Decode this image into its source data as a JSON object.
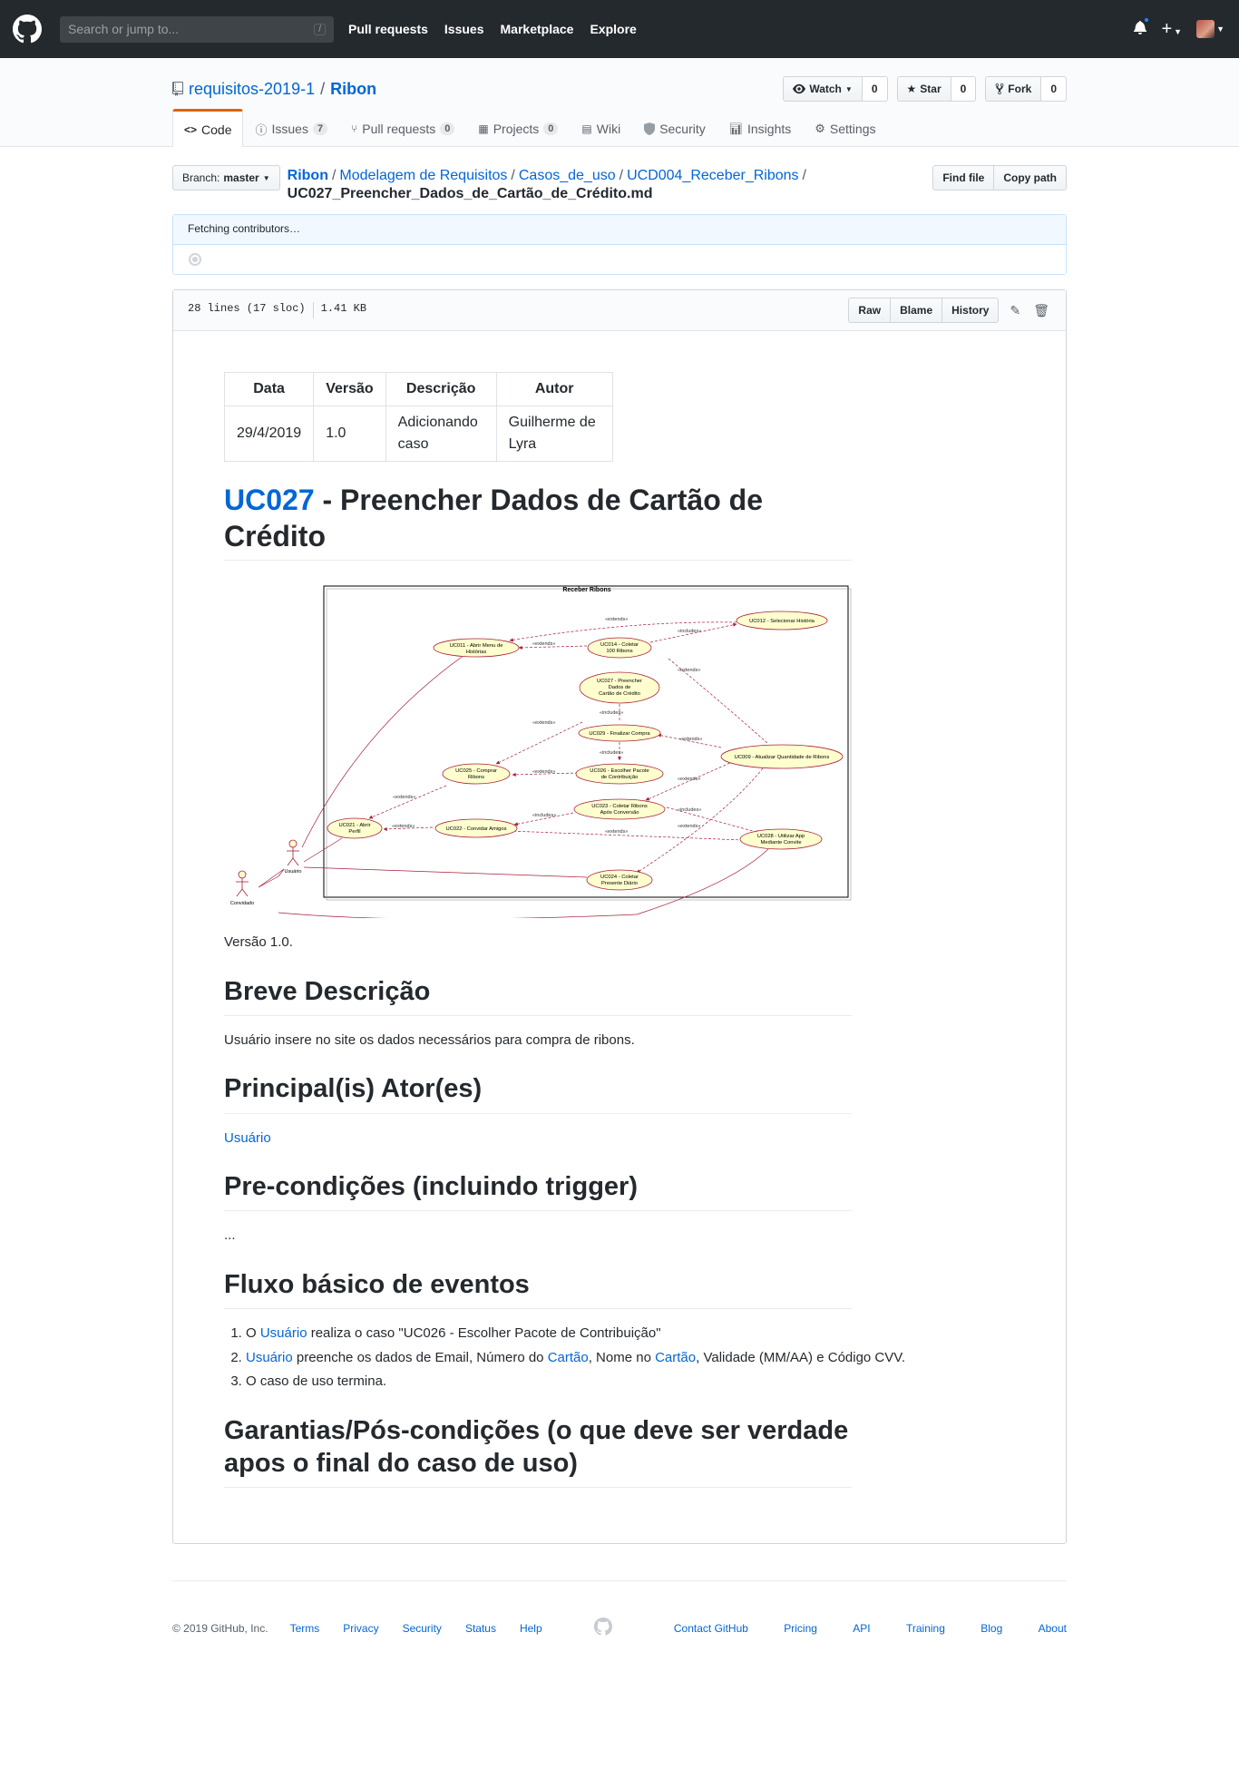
{
  "header": {
    "search_placeholder": "Search or jump to...",
    "search_key": "/",
    "nav": [
      "Pull requests",
      "Issues",
      "Marketplace",
      "Explore"
    ],
    "plus": "+"
  },
  "repo": {
    "owner": "requisitos-2019-1",
    "name": "Ribon",
    "watch_label": "Watch",
    "watch_count": "0",
    "star_label": "Star",
    "star_count": "0",
    "fork_label": "Fork",
    "fork_count": "0",
    "tabs": [
      {
        "label": "Code",
        "icon": "code-icon"
      },
      {
        "label": "Issues",
        "count": "7",
        "icon": "issue-icon"
      },
      {
        "label": "Pull requests",
        "count": "0",
        "icon": "pr-icon"
      },
      {
        "label": "Projects",
        "count": "0",
        "icon": "project-icon"
      },
      {
        "label": "Wiki",
        "icon": "book-icon"
      },
      {
        "label": "Security",
        "icon": "shield-icon"
      },
      {
        "label": "Insights",
        "icon": "graph-icon"
      },
      {
        "label": "Settings",
        "icon": "gear-icon"
      }
    ]
  },
  "breadcrumb": {
    "branch_prefix": "Branch:",
    "branch": "master",
    "root": "Ribon",
    "path": [
      "Modelagem de Requisitos",
      "Casos_de_uso",
      "UCD004_Receber_Ribons"
    ],
    "file": "UC027_Preencher_Dados_de_Cartão_de_Crédito.md",
    "find_file": "Find file",
    "copy_path": "Copy path"
  },
  "contributors": {
    "text": "Fetching contributors…"
  },
  "file": {
    "lines": "28 lines (17 sloc)",
    "size": "1.41 KB",
    "raw": "Raw",
    "blame": "Blame",
    "history": "History"
  },
  "doc": {
    "table_headers": [
      "Data",
      "Versão",
      "Descrição",
      "Autor"
    ],
    "table_row": [
      "29/4/2019",
      "1.0",
      "Adicionando caso",
      "Guilherme de Lyra"
    ],
    "title_link": "UC027",
    "title_rest": " - Preencher Dados de Cartão de Crédito",
    "diagram": {
      "title": "Receber Ribons",
      "usecases": {
        "uc011": [
          "UC011 - Abrir Menu de",
          "Histórias"
        ],
        "uc014": [
          "UC014 - Coletar",
          "100 Ribons"
        ],
        "uc012": [
          "UC012 - Selecionar História"
        ],
        "uc027": [
          "UC027 - Preencher",
          "Dados de",
          "Cartão de Crédito"
        ],
        "uc029": [
          "UC029 - Finalizar Compra"
        ],
        "uc009": [
          "UC009 - Atualizar Quantidade de Ribons"
        ],
        "uc025": [
          "UC025 - Comprar",
          "Ribons"
        ],
        "uc026": [
          "UC026 - Escolher Pacote",
          "de Contribuição"
        ],
        "uc023": [
          "UC023 - Coletar Ribons",
          "Após Conversão"
        ],
        "uc021": [
          "UC021 - Abrir",
          "Perfil"
        ],
        "uc022": [
          "UC022 - Convidar Amigos"
        ],
        "uc028": [
          "UC028 - Utilizar App",
          "Mediante Convite"
        ],
        "uc024": [
          "UC024 - Coletar",
          "Presente Diário"
        ]
      },
      "actors": {
        "usuario": "Usuário",
        "convidado": "Convidado"
      },
      "extends": "«extends»",
      "includes": "«includes»"
    },
    "version": "Versão 1.0.",
    "h_descricao": "Breve Descrição",
    "descricao": "Usuário insere no site os dados necessários para compra de ribons.",
    "h_atores": "Principal(is) Ator(es)",
    "ator": "Usuário",
    "h_precond": "Pre-condições (incluindo trigger)",
    "precond": "...",
    "h_fluxo": "Fluxo básico de eventos",
    "fluxo": {
      "i1_pre": "O ",
      "i1_link": "Usuário",
      "i1_post": " realiza o caso \"UC026 - Escolher Pacote de Contribuição\"",
      "i2_link1": "Usuário",
      "i2_mid1": " preenche os dados de Email, Número do ",
      "i2_link2": "Cartão",
      "i2_mid2": ", Nome no ",
      "i2_link3": "Cartão",
      "i2_post": ", Validade (MM/AA) e Código CVV.",
      "i3": "O caso de uso termina."
    },
    "h_garantias": "Garantias/Pós-condições (o que deve ser verdade apos o final do caso de uso)"
  },
  "footer": {
    "copyright": "© 2019 GitHub, Inc.",
    "left_links": [
      "Terms",
      "Privacy",
      "Security",
      "Status",
      "Help"
    ],
    "right_links": [
      "Contact GitHub",
      "Pricing",
      "API",
      "Training",
      "Blog",
      "About"
    ]
  }
}
